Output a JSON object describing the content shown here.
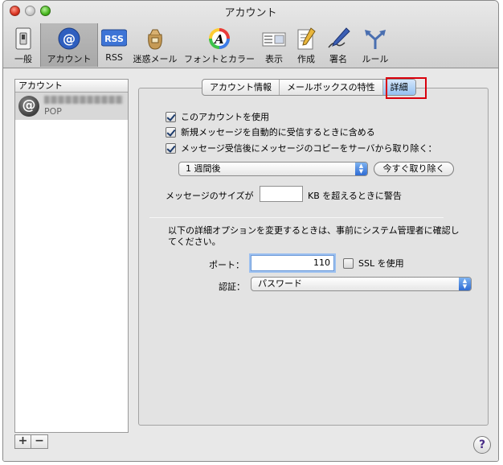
{
  "window": {
    "title": "アカウント"
  },
  "toolbar": {
    "items": [
      {
        "label": "一般"
      },
      {
        "label": "アカウント"
      },
      {
        "label": "RSS"
      },
      {
        "label": "迷惑メール"
      },
      {
        "label": "フォントとカラー"
      },
      {
        "label": "表示"
      },
      {
        "label": "作成"
      },
      {
        "label": "署名"
      },
      {
        "label": "ルール"
      }
    ],
    "rss_icon_text": "RSS",
    "font_icon_text": "A"
  },
  "accounts": {
    "header": "アカウント",
    "list": [
      {
        "type": "POP",
        "icon": "at-icon"
      }
    ],
    "add_label": "+",
    "remove_label": "−"
  },
  "tabs": {
    "items": [
      {
        "label": "アカウント情報"
      },
      {
        "label": "メールボックスの特性"
      },
      {
        "label": "詳細"
      }
    ],
    "active": "詳細"
  },
  "advanced": {
    "enable_account": "このアカウントを使用",
    "auto_check": "新規メッセージを自動的に受信するときに含める",
    "remove_copy": "メッセージ受信後にメッセージのコピーをサーバから取り除く：",
    "remove_after_value": "1 週間後",
    "remove_now_label": "今すぐ取り除く",
    "size_warning_prefix": "メッセージのサイズが",
    "size_warning_value": "",
    "size_warning_suffix": "KB を超えるときに警告",
    "notice": "以下の詳細オプションを変更するときは、事前にシステム管理者に確認してください。",
    "port_label": "ポート：",
    "port_value": "110",
    "ssl_label": "SSL を使用",
    "auth_label": "認証：",
    "auth_value": "パスワード"
  },
  "help_label": "?"
}
